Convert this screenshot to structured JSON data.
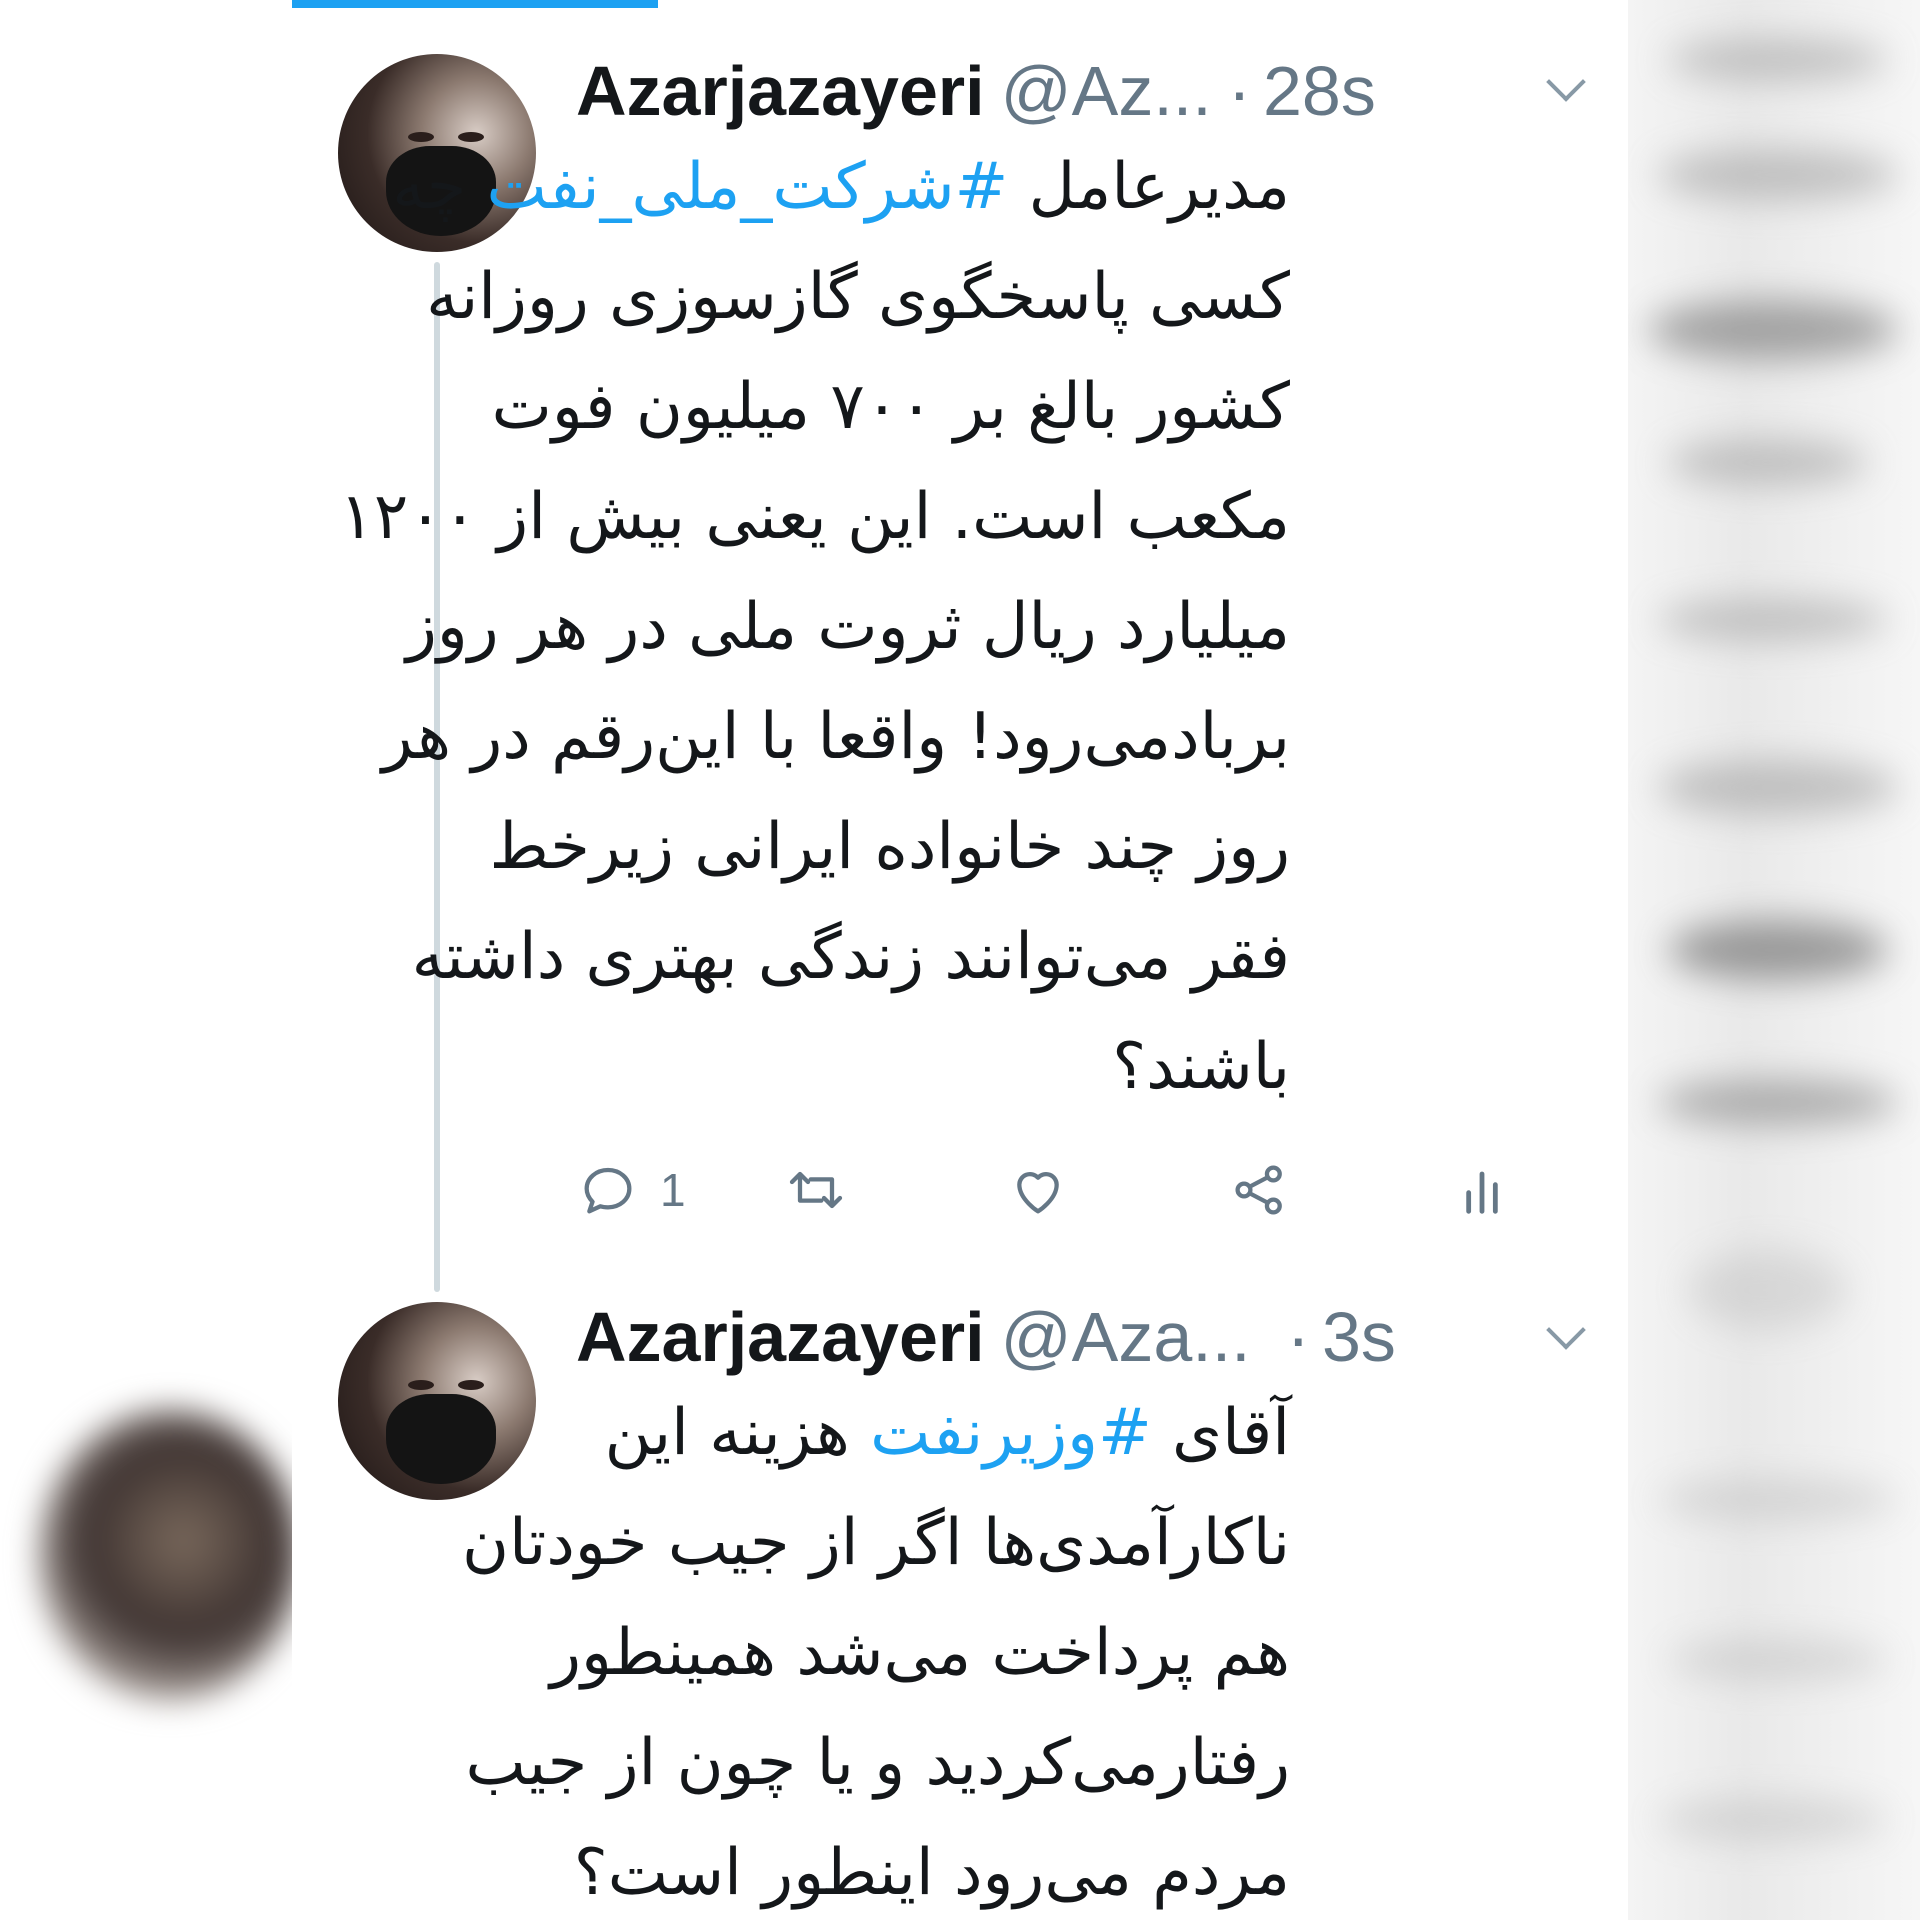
{
  "tweets": [
    {
      "name": "Azarjazayeri",
      "handle": "@Az...",
      "separator": "·",
      "time": "28s",
      "lines": [
        {
          "before": "مدیرعامل ",
          "hashtag": "#شرکت_ملی_نفت",
          "after": " چه"
        },
        {
          "text": "کسی پاسخگوی گازسوزی روزانه"
        },
        {
          "text": "کشور بالغ بر ۷۰۰ میلیون فوت"
        },
        {
          "text": "مکعب است. این یعنی بیش از ۱۲۰۰"
        },
        {
          "text": "میلیارد ریال ثروت ملی در هر روز"
        },
        {
          "text": "بربادمی‌رود! واقعا با این‌رقم در هر"
        },
        {
          "text": "روز چند خانواده ایرانی زیرخط"
        },
        {
          "text": "فقر می‌توانند زندگی بهتری داشته"
        },
        {
          "text": "باشند؟"
        }
      ],
      "reply_count": "1",
      "icons": [
        "reply-icon",
        "retweet-icon",
        "like-icon",
        "share-icon",
        "analytics-icon"
      ]
    },
    {
      "name": "Azarjazayeri",
      "handle": "@Aza...",
      "separator": "·",
      "time": "3s",
      "lines": [
        {
          "before": "آقای ",
          "hashtag": "#وزیرنفت",
          "after": " هزینه این"
        },
        {
          "text": "ناکارآمدی‌ها اگر از جیب خودتان"
        },
        {
          "text": "هم پرداخت می‌شد همینطور"
        },
        {
          "text": "رفتارمی‌کردید و یا چون از جیب"
        },
        {
          "text": "مردم می‌رود اینطور است؟"
        }
      ]
    }
  ],
  "colors": {
    "accent": "#1da1f2",
    "text": "#14171a",
    "muted": "#657786",
    "thread_line": "#cfd9de"
  }
}
